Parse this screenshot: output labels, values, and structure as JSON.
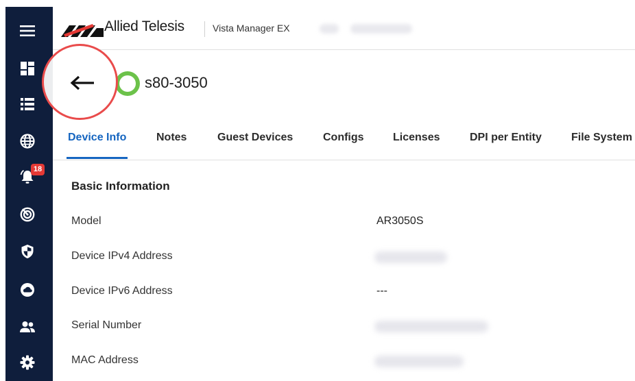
{
  "sidebar": {
    "items": [
      {
        "name": "menu-icon"
      },
      {
        "name": "dashboard-icon"
      },
      {
        "name": "list-icon"
      },
      {
        "name": "globe-icon"
      },
      {
        "name": "notification-icon",
        "badge": "18"
      },
      {
        "name": "radar-icon"
      },
      {
        "name": "shield-icon"
      },
      {
        "name": "cloud-icon"
      },
      {
        "name": "users-icon"
      },
      {
        "name": "gear-icon"
      }
    ]
  },
  "header": {
    "brand": "Allied Telesis",
    "product": "Vista Manager EX"
  },
  "device": {
    "name": "s80-3050"
  },
  "tabs": [
    {
      "label": "Device Info",
      "active": true
    },
    {
      "label": "Notes"
    },
    {
      "label": "Guest Devices"
    },
    {
      "label": "Configs"
    },
    {
      "label": "Licenses"
    },
    {
      "label": "DPI per Entity"
    },
    {
      "label": "File System"
    }
  ],
  "basic_info": {
    "title": "Basic Information",
    "rows": [
      {
        "label": "Model",
        "value": "AR3050S"
      },
      {
        "label": "Device IPv4 Address",
        "value": ""
      },
      {
        "label": "Device IPv6 Address",
        "value": "---"
      },
      {
        "label": "Serial Number",
        "value": ""
      },
      {
        "label": "MAC Address",
        "value": ""
      }
    ]
  },
  "colors": {
    "sidebar": "#0f1e3c",
    "accent": "#1565c0",
    "badge": "#e53935",
    "device_status": "#6cc24a",
    "highlight": "#e94b4b"
  }
}
